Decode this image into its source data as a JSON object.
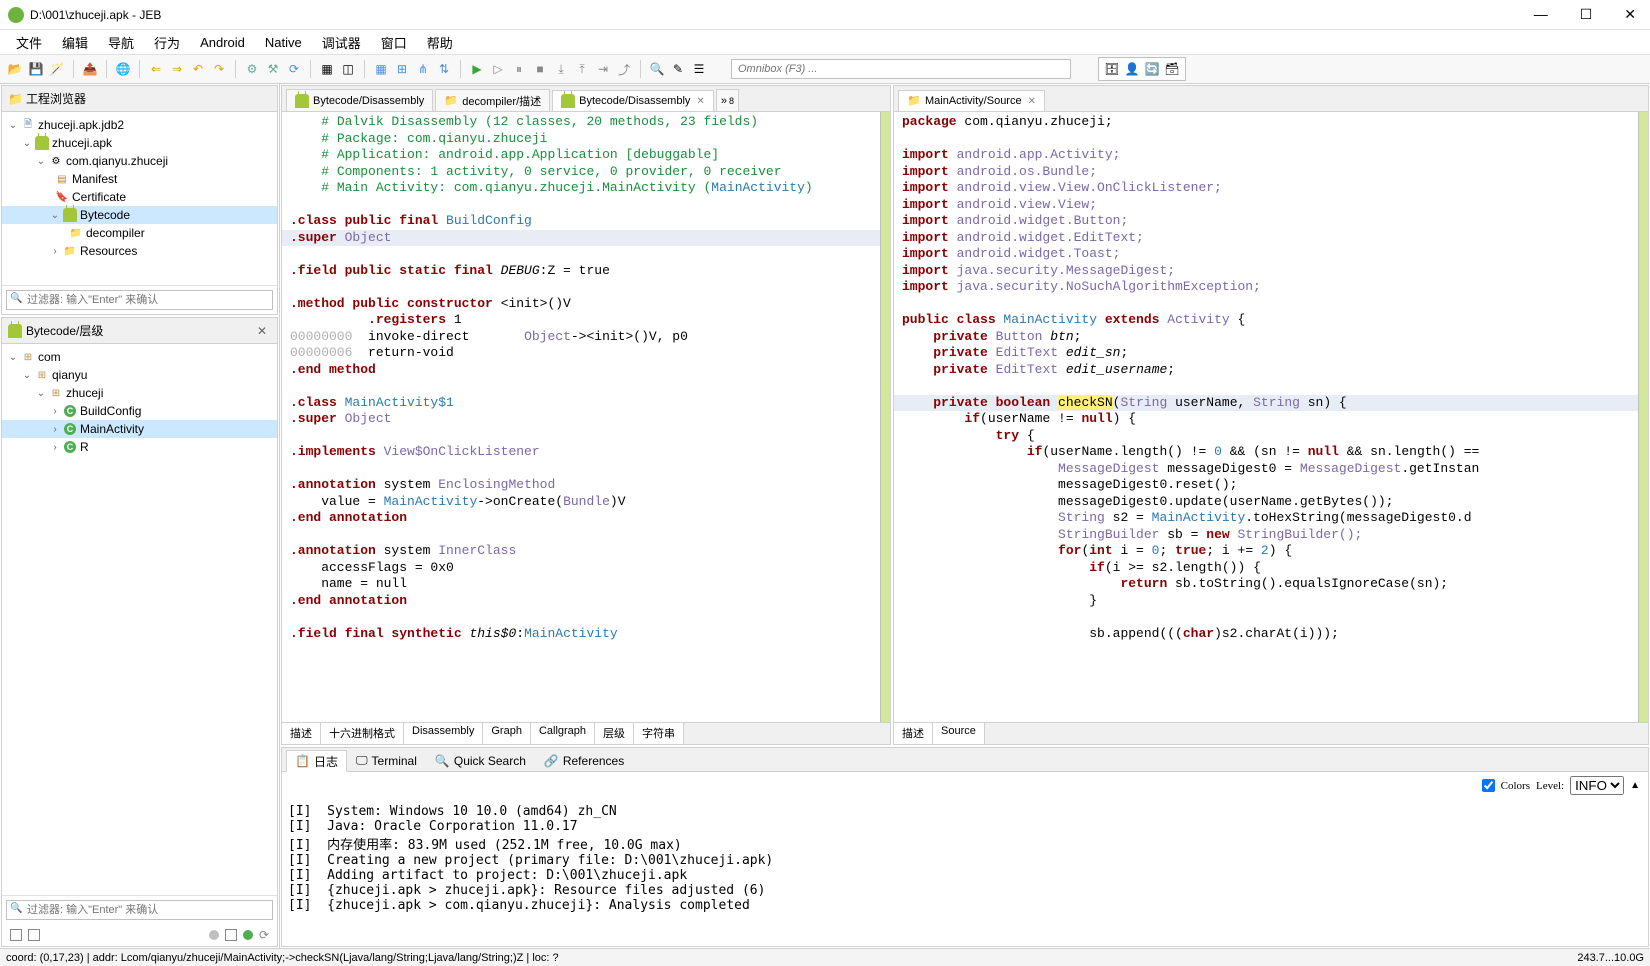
{
  "window": {
    "title": "D:\\001\\zhuceji.apk - JEB",
    "minimize": "—",
    "maximize": "☐",
    "close": "✕"
  },
  "menu": [
    "文件",
    "编辑",
    "导航",
    "行为",
    "Android",
    "Native",
    "调试器",
    "窗口",
    "帮助"
  ],
  "omnibox_placeholder": "Omnibox (F3) ...",
  "project_panel": {
    "title": "工程浏览器",
    "filter_placeholder": "过滤器: 输入\"Enter\" 来确认",
    "root": "zhuceji.apk.jdb2",
    "apk": "zhuceji.apk",
    "package": "com.qianyu.zhuceji",
    "manifest": "Manifest",
    "certificate": "Certificate",
    "bytecode": "Bytecode",
    "decompiler": "decompiler",
    "resources": "Resources"
  },
  "hierarchy_panel": {
    "title": "Bytecode/层级",
    "com": "com",
    "qianyu": "qianyu",
    "zhuceji": "zhuceji",
    "buildconfig": "BuildConfig",
    "mainactivity": "MainActivity",
    "r": "R",
    "filter_placeholder": "过滤器: 输入\"Enter\" 来确认"
  },
  "left_editor": {
    "tabs": [
      "Bytecode/Disassembly",
      "decompiler/描述",
      "Bytecode/Disassembly"
    ],
    "more": "»",
    "more_count": "8",
    "subtabs": [
      "描述",
      "十六进制格式",
      "Disassembly",
      "Graph",
      "Callgraph",
      "层级",
      "字符串"
    ]
  },
  "right_editor": {
    "tab": "MainActivity/Source",
    "subtabs": [
      "描述",
      "Source"
    ]
  },
  "disasm": {
    "l1": "# Dalvik Disassembly (12 classes, 20 methods, 23 fields)",
    "l2": "# Package: com.qianyu.zhuceji",
    "l3": "# Application: android.app.Application [debuggable]",
    "l4": "# Components: 1 activity, 0 service, 0 provider, 0 receiver",
    "l5a": "# Main Activity: com.qianyu.zhuceji.MainActivity (",
    "l5b": "MainActivity",
    "l5c": ")",
    "classpub": ".class public final ",
    "buildconfig": "BuildConfig",
    "super": ".super ",
    "object": "Object",
    "field_debug": ".field public static final ",
    "debug_sig": "DEBUG",
    "debug_tail": ":Z = true",
    "method_init": ".method public constructor ",
    "init_sig": "<init>",
    "init_tail": "()V",
    "registers": "          .registers ",
    "reg1": "1",
    "addr0": "00000000",
    "invoke": "  invoke-direct       ",
    "object2": "Object",
    "invoke_tail": "-><init>()V, p0",
    "addr6": "00000006",
    "retvoid": "  return-void",
    "endmethod": ".end method",
    "class_main1": ".class ",
    "mainact1": "MainActivity$1",
    "implements": ".implements ",
    "viewclick": "View$OnClickListener",
    "annotation": ".annotation",
    "system": " system ",
    "enclosing": "EnclosingMethod",
    "value_eq": "    value = ",
    "mainactivity": "MainActivity",
    "oncreate": "->onCreate(",
    "bundle": "Bundle",
    "oncreate_tail": ")V",
    "endannotation": ".end annotation",
    "innerclass": "InnerClass",
    "accessflags": "    accessFlags = 0x0",
    "name_null": "    name = null",
    "field_final": ".field final synthetic ",
    "this0": "this$0",
    "this0_tail": ":",
    "mainactivity2": "MainActivity"
  },
  "src": {
    "package": "package",
    "pkg_name": " com.qianyu.zhuceji;",
    "import": "import",
    "imp1": " android.app.Activity;",
    "imp2": " android.os.Bundle;",
    "imp3": " android.view.View.OnClickListener;",
    "imp4": " android.view.View;",
    "imp5": " android.widget.Button;",
    "imp6": " android.widget.EditText;",
    "imp7": " android.widget.Toast;",
    "imp8": " java.security.MessageDigest;",
    "imp9": " java.security.NoSuchAlgorithmException;",
    "public": "public",
    "class": " class ",
    "mainactivity": "MainActivity",
    "extends": " extends ",
    "activity": "Activity",
    "brace": " {",
    "private": "private",
    "button": "Button",
    "btn": "btn",
    "semi": ";",
    "edittext": "EditText",
    "edit_sn": "edit_sn",
    "edit_username": "edit_username",
    "boolean": " boolean ",
    "checksn": "checkSN",
    "string": "String",
    "username": " userName, ",
    "sn": " sn) {",
    "if": "if",
    "cond1": "(userName != ",
    "null": "null",
    "cond1b": ") {",
    "try": "try",
    "tryb": " {",
    "cond2a": "(userName.length() != ",
    "zero": "0",
    "cond2b": " && (sn != ",
    "cond2c": " && sn.length() ==",
    "msgdigest": "MessageDigest",
    "md0": " messageDigest0 = ",
    "getinstance": ".getInstan",
    "reset": "messageDigest0.reset();",
    "update": "messageDigest0.update(userName.getBytes());",
    "s2a": " s2 = ",
    "tohex": ".toHexString(messageDigest0.d",
    "sb_type": "StringBuilder",
    "sb_decl": " sb = ",
    "new": "new",
    "sb_new": " StringBuilder();",
    "for": "for",
    "int": "int",
    "for_a": "(",
    "for_b": " i = ",
    "for_c": "; ",
    "true": "true",
    "for_d": "; i += ",
    "two": "2",
    "for_e": ") {",
    "if_len": "(i >= s2.length()) {",
    "return": "return",
    "ret_expr": " sb.toString().equalsIgnoreCase(sn);",
    "closeb": "}",
    "append_a": "sb.append(((",
    "char": "char",
    "append_b": ")s2.charAt(i)));"
  },
  "bottom": {
    "tabs": [
      "日志",
      "Terminal",
      "Quick Search",
      "References"
    ],
    "colors": "Colors",
    "level": "Level:",
    "level_value": "INFO",
    "log1": "[I]  System: Windows 10 10.0 (amd64) zh_CN",
    "log2": "[I]  Java: Oracle Corporation 11.0.17",
    "log3": "[I]  内存使用率: 83.9M used (252.1M free, 10.0G max)",
    "log4": "[I]  Creating a new project (primary file: D:\\001\\zhuceji.apk)",
    "log5": "[I]  Adding artifact to project: D:\\001\\zhuceji.apk",
    "log6": "[I]  {zhuceji.apk > zhuceji.apk}: Resource files adjusted (6)",
    "log7": "[I]  {zhuceji.apk > com.qianyu.zhuceji}: Analysis completed"
  },
  "status": {
    "left": "coord: (0,17,23) | addr: Lcom/qianyu/zhuceji/MainActivity;->checkSN(Ljava/lang/String;Ljava/lang/String;)Z | loc: ?",
    "right": "243.7...10.0G"
  }
}
